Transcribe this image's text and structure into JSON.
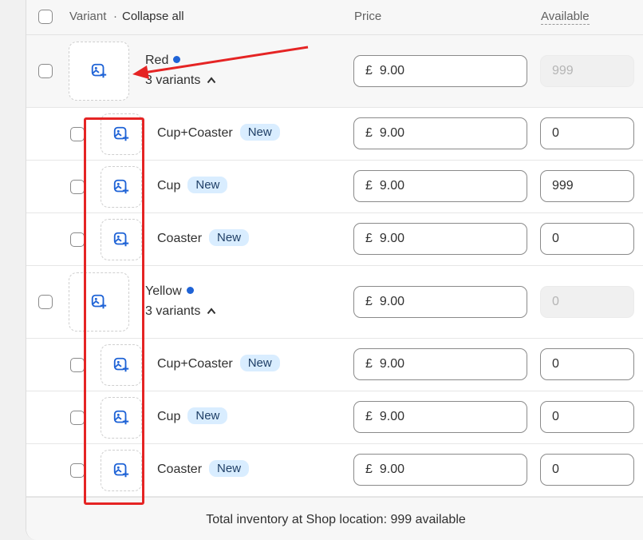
{
  "header": {
    "variant_label": "Variant",
    "separator": "·",
    "collapse_all": "Collapse all",
    "price_label": "Price",
    "available_label": "Available"
  },
  "groups": [
    {
      "name": "Red",
      "variants_count": "3 variants",
      "currency": "£",
      "price": "9.00",
      "available": "999",
      "children": [
        {
          "name": "Cup+Coaster",
          "badge": "New",
          "currency": "£",
          "price": "9.00",
          "available": "0"
        },
        {
          "name": "Cup",
          "badge": "New",
          "currency": "£",
          "price": "9.00",
          "available": "999"
        },
        {
          "name": "Coaster",
          "badge": "New",
          "currency": "£",
          "price": "9.00",
          "available": "0"
        }
      ]
    },
    {
      "name": "Yellow",
      "variants_count": "3 variants",
      "currency": "£",
      "price": "9.00",
      "available": "0",
      "children": [
        {
          "name": "Cup+Coaster",
          "badge": "New",
          "currency": "£",
          "price": "9.00",
          "available": "0"
        },
        {
          "name": "Cup",
          "badge": "New",
          "currency": "£",
          "price": "9.00",
          "available": "0"
        },
        {
          "name": "Coaster",
          "badge": "New",
          "currency": "£",
          "price": "9.00",
          "available": "0"
        }
      ]
    }
  ],
  "footer": {
    "total_inventory": "Total inventory at Shop location: 999 available"
  },
  "colors": {
    "accent_blue": "#1f63d6",
    "badge_bg": "#d9edff",
    "annotation_red": "#e52424"
  },
  "icons": {
    "add_image": "add-image-icon",
    "chevron": "chevron-up-icon"
  }
}
